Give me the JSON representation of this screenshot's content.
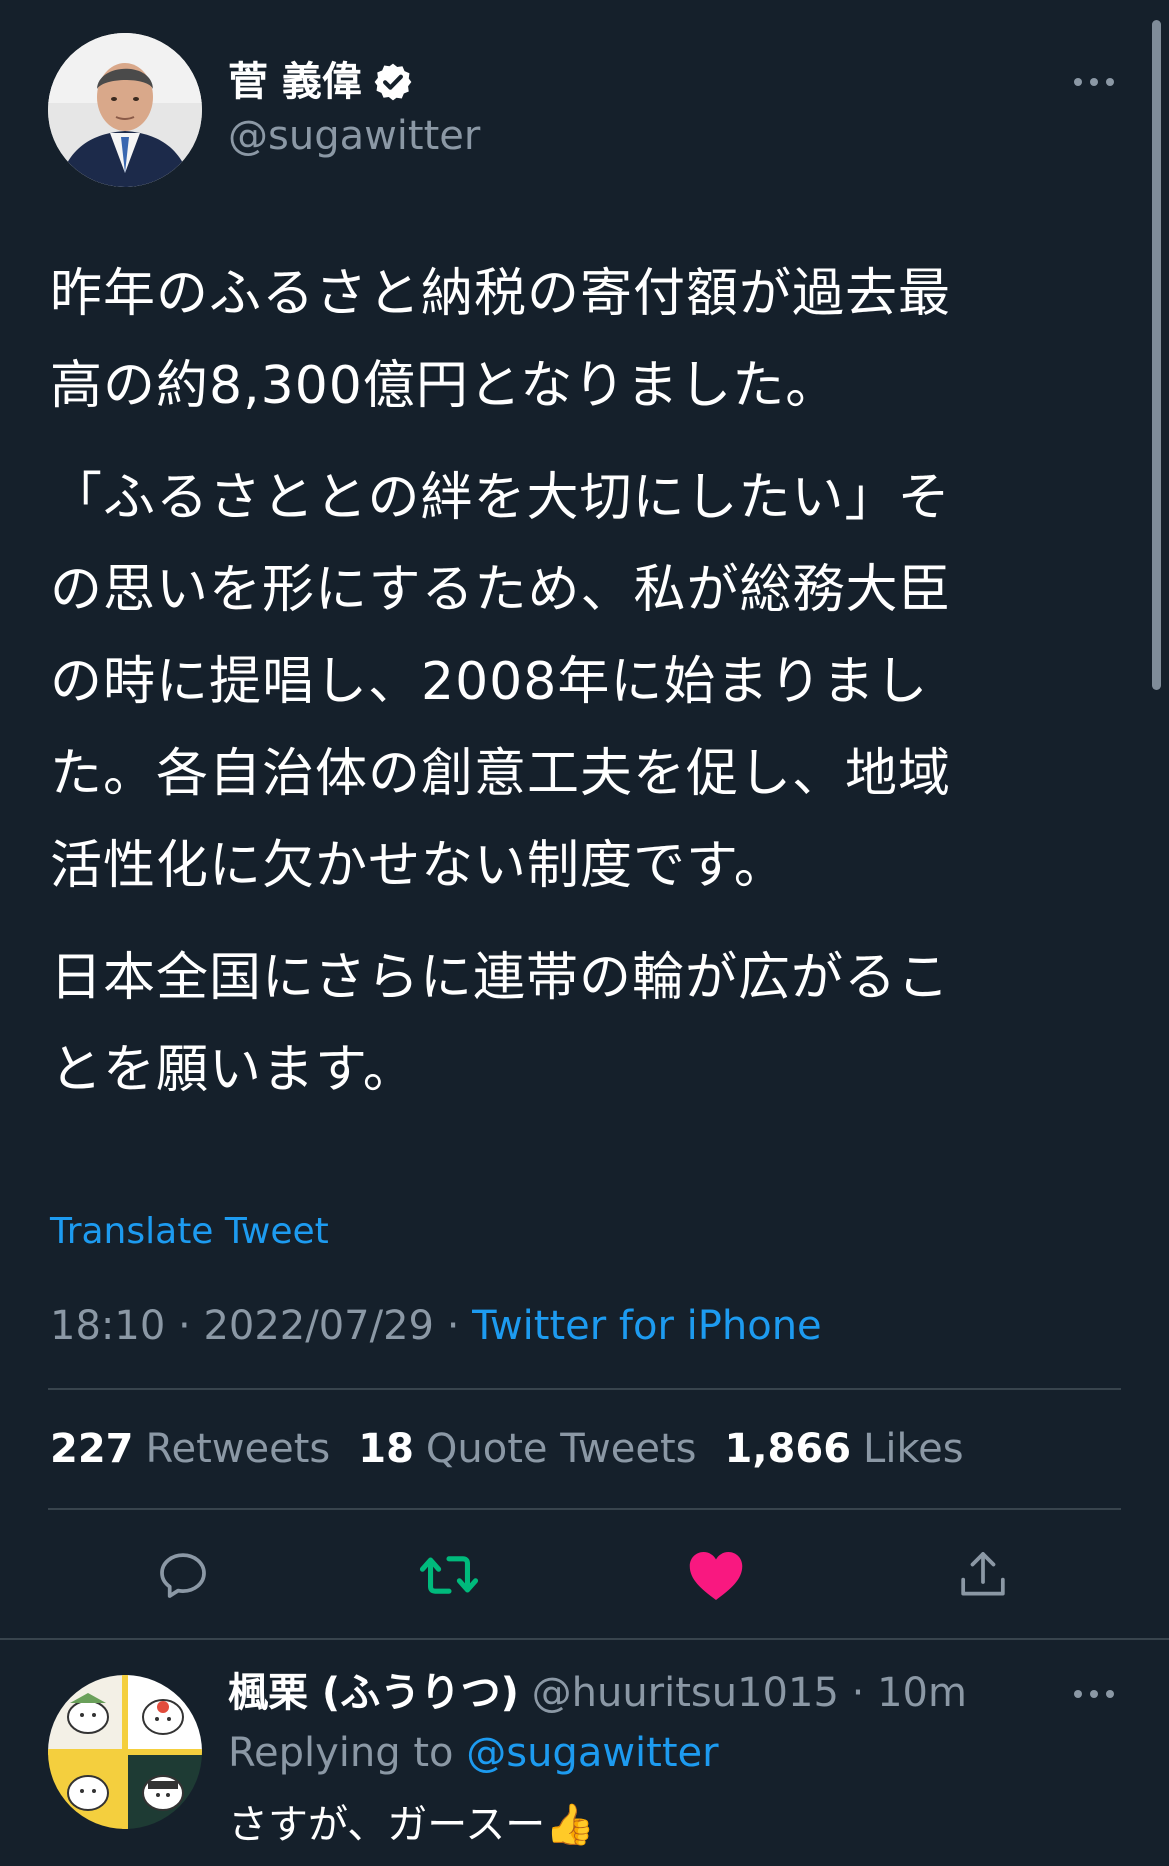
{
  "tweet": {
    "author": {
      "name": "菅 義偉",
      "handle": "@sugawitter",
      "verified": true
    },
    "paragraphs": [
      "昨年のふるさと納税の寄付額が過去最\n高の約8,300億円となりました。",
      "「ふるさととの絆を大切にしたい」そ\nの思いを形にするため、私が総務大臣\nの時に提唱し、2008年に始まりまし\nた。各自治体の創意工夫を促し、地域\n活性化に欠かせない制度です。",
      "日本全国にさらに連帯の輪が広がるこ\nとを願います。"
    ],
    "translate_label": "Translate Tweet",
    "time": "18:10",
    "date": "2022/07/29",
    "separator": "·",
    "source": "Twitter for iPhone",
    "stats": {
      "retweets_count": "227",
      "retweets_label": "Retweets",
      "quotes_count": "18",
      "quotes_label": "Quote Tweets",
      "likes_count": "1,866",
      "likes_label": "Likes"
    },
    "liked": true
  },
  "reply": {
    "name": "楓栗 (ふうりつ)",
    "handle": "@huuritsu1015",
    "separator": "·",
    "age": "10m",
    "replying_prefix": "Replying to",
    "replying_to": "@sugawitter",
    "text": "さすが、ガースー👍"
  },
  "icons": {
    "more": "more-horizontal-icon",
    "reply": "reply-icon",
    "retweet": "retweet-icon",
    "like": "heart-icon",
    "share": "share-icon",
    "verified": "verified-badge-icon"
  },
  "colors": {
    "background": "#15202b",
    "accent": "#1d9bf0",
    "retweet": "#00ba7c",
    "like": "#f91880",
    "muted": "#8b98a5"
  }
}
